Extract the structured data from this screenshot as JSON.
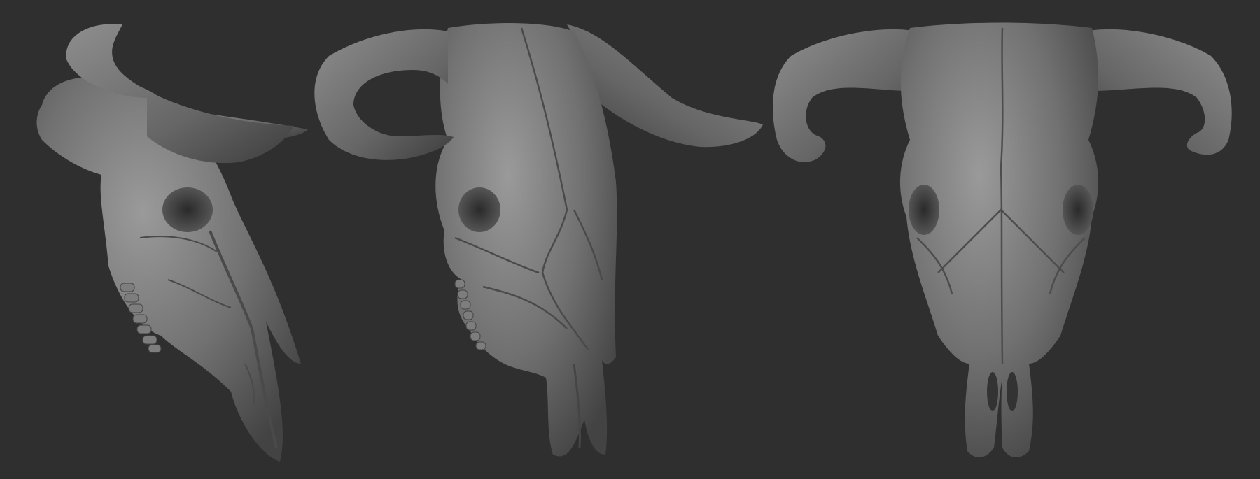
{
  "scene": {
    "background_color": "#2f2f2f",
    "bone_color": "#6e6e6e",
    "highlight_color": "#8c8c8c",
    "shadow_color": "#3a3a3a",
    "views": [
      {
        "id": "skull-three-quarter-left",
        "description_icon": "bull-skull-icon"
      },
      {
        "id": "skull-side-left",
        "description_icon": "bull-skull-icon"
      },
      {
        "id": "skull-front",
        "description_icon": "bull-skull-icon"
      }
    ]
  }
}
